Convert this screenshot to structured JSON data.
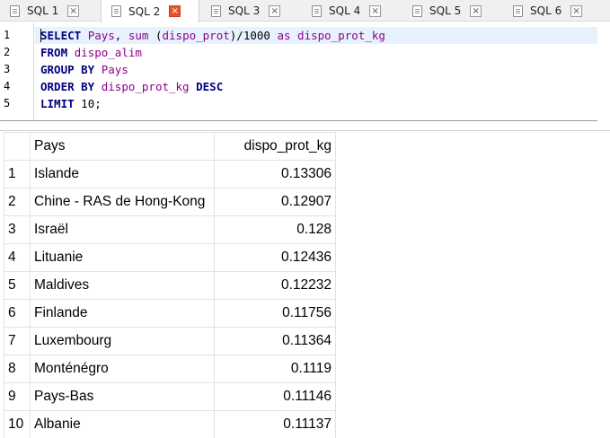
{
  "tabs": [
    {
      "label": "SQL 1",
      "active": false
    },
    {
      "label": "SQL 2",
      "active": true
    },
    {
      "label": "SQL 3",
      "active": false
    },
    {
      "label": "SQL 4",
      "active": false
    },
    {
      "label": "SQL 5",
      "active": false
    },
    {
      "label": "SQL 6",
      "active": false
    }
  ],
  "tab_close_glyph": "×",
  "editor": {
    "line_numbers": [
      "1",
      "2",
      "3",
      "4",
      "5"
    ],
    "code": {
      "l1": {
        "kw1": "SELECT",
        "id1": "Pays",
        "p1": ",",
        "kw2": "sum",
        "p2": "(",
        "id2": "dispo_prot",
        "p3": ")/1000",
        "kw3": "as",
        "id3": "dispo_prot_kg"
      },
      "l2": {
        "kw1": "FROM",
        "id1": "dispo_alim"
      },
      "l3": {
        "kw1": "GROUP BY",
        "id1": "Pays"
      },
      "l4": {
        "kw1": "ORDER BY",
        "id1": "dispo_prot_kg",
        "kw2": "DESC"
      },
      "l5": {
        "kw1": "LIMIT",
        "p1": "10;"
      }
    }
  },
  "results": {
    "columns": [
      "",
      "Pays",
      "dispo_prot_kg"
    ],
    "rows": [
      [
        "1",
        "Islande",
        "0.13306"
      ],
      [
        "2",
        "Chine - RAS de Hong-Kong",
        "0.12907"
      ],
      [
        "3",
        "Israël",
        "0.128"
      ],
      [
        "4",
        "Lituanie",
        "0.12436"
      ],
      [
        "5",
        "Maldives",
        "0.12232"
      ],
      [
        "6",
        "Finlande",
        "0.11756"
      ],
      [
        "7",
        "Luxembourg",
        "0.11364"
      ],
      [
        "8",
        "Monténégro",
        "0.1119"
      ],
      [
        "9",
        "Pays-Bas",
        "0.11146"
      ],
      [
        "10",
        "Albanie",
        "0.11137"
      ]
    ]
  }
}
